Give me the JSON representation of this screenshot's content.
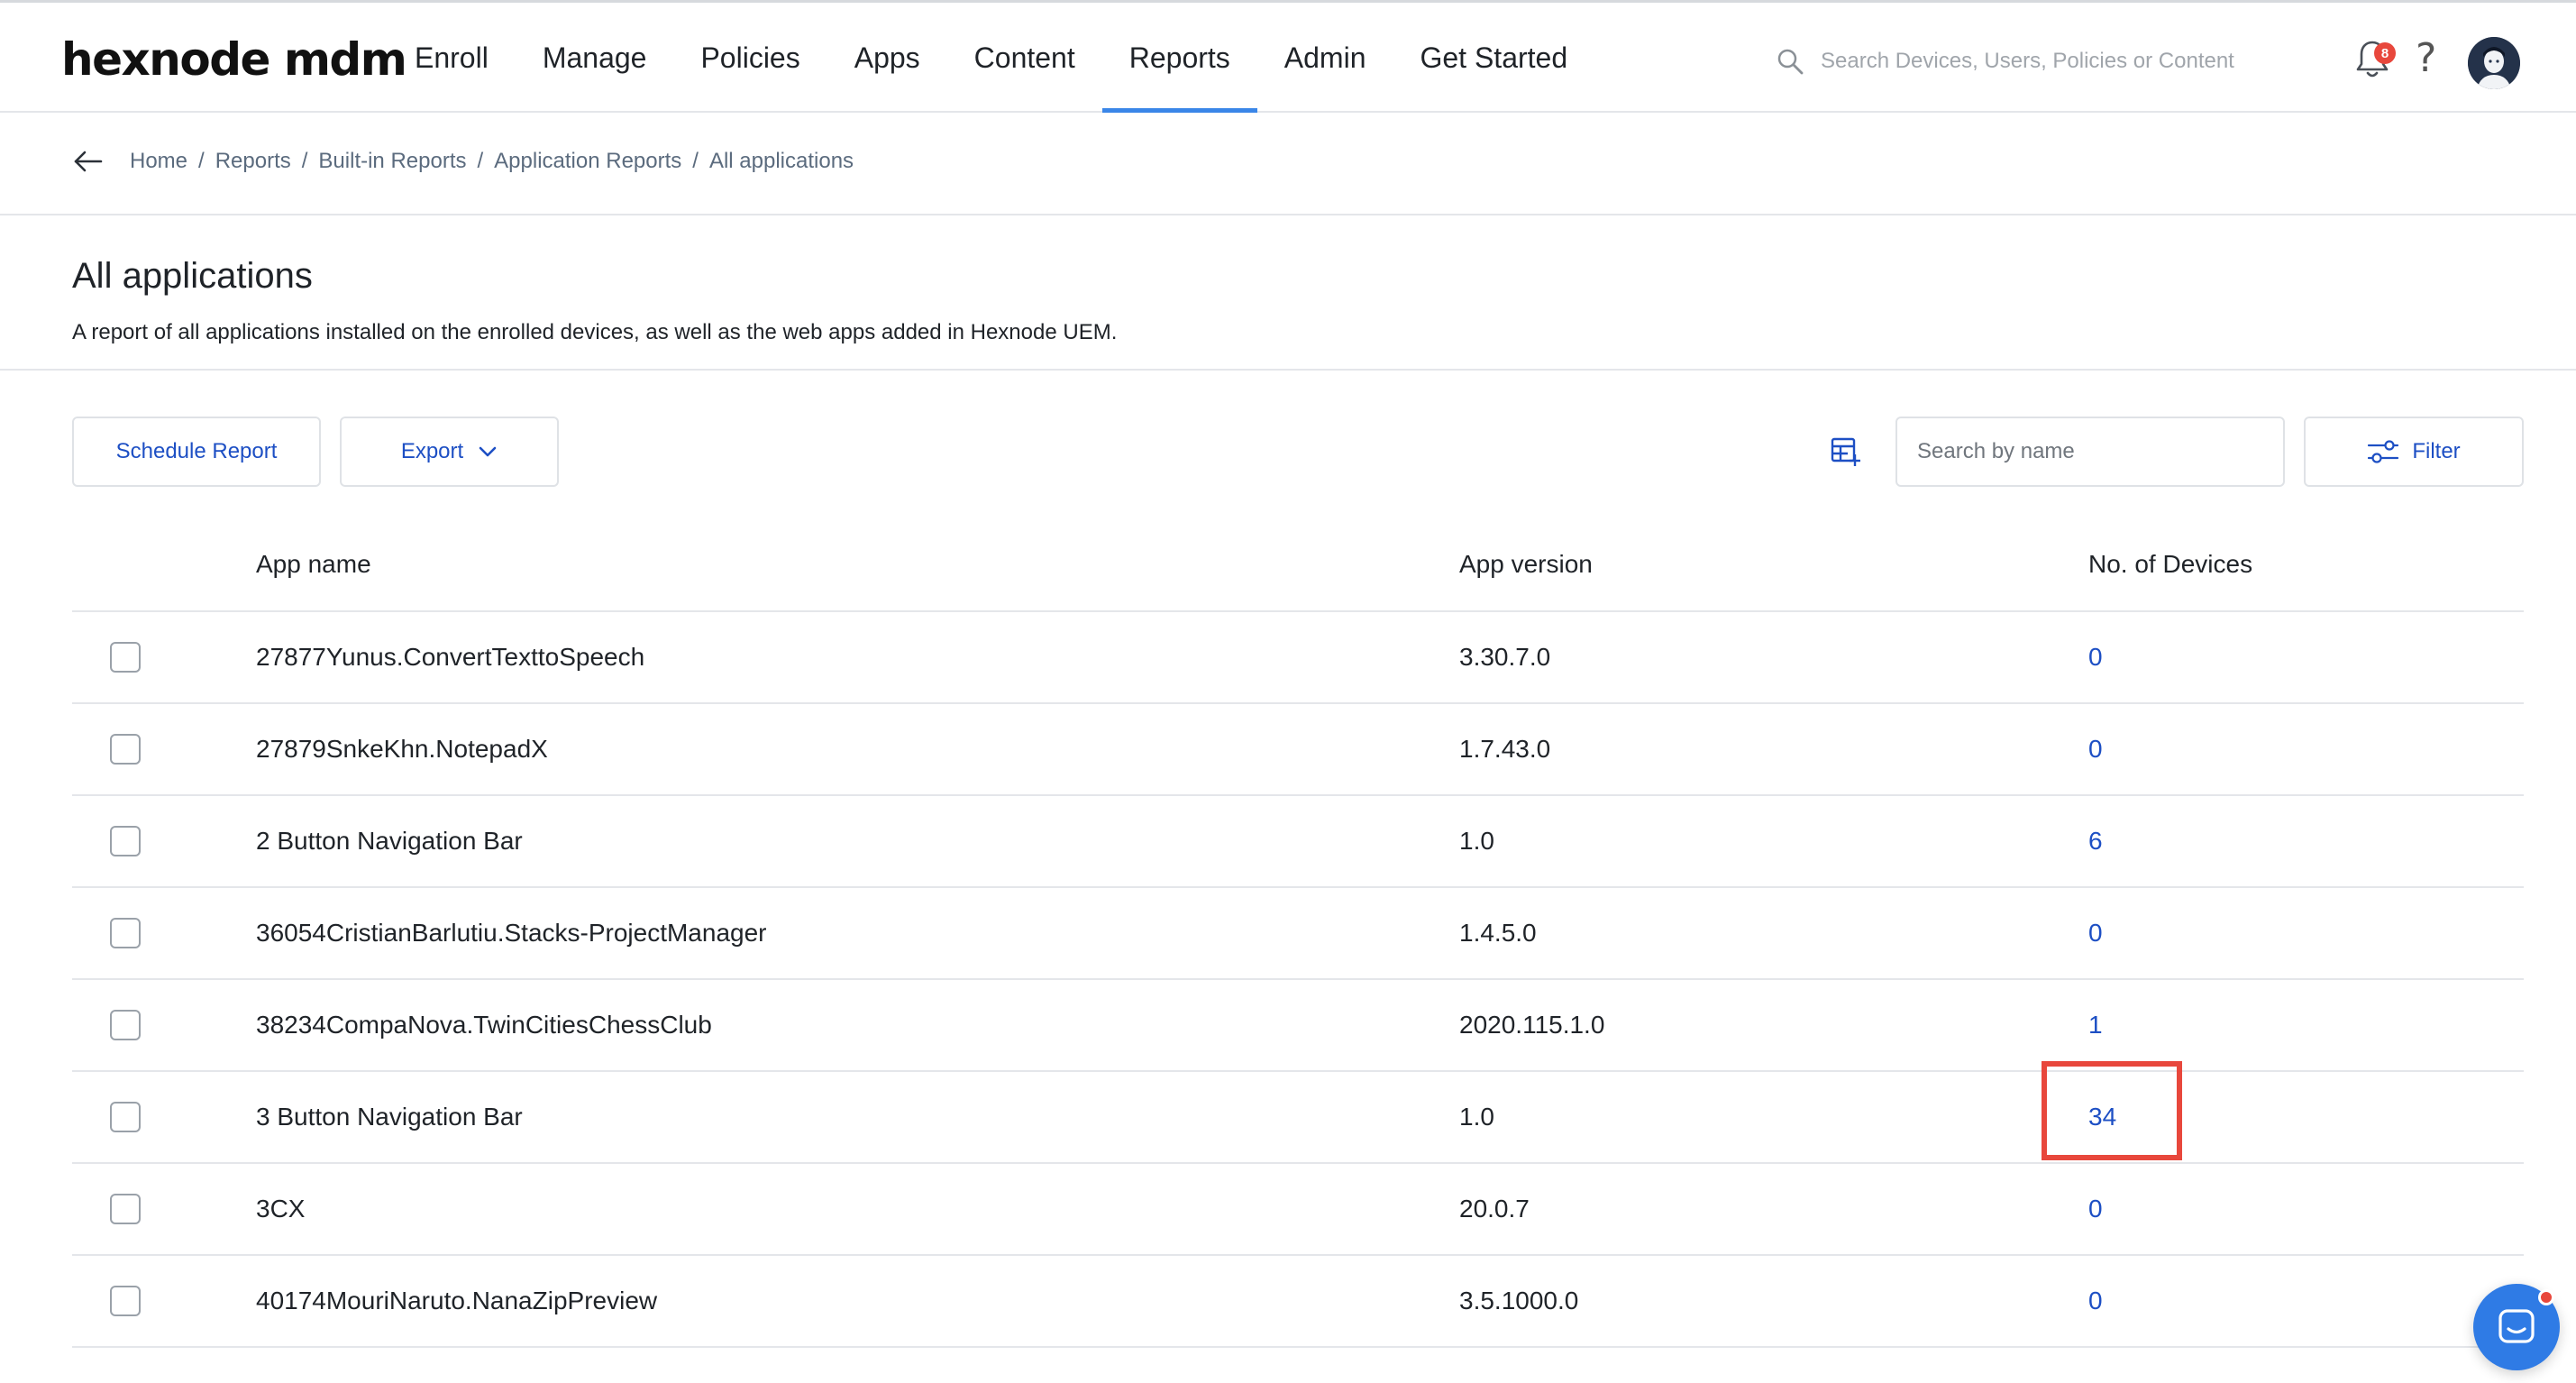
{
  "brand": {
    "logo_text": "hexnode mdm"
  },
  "nav": {
    "items": [
      {
        "label": "Enroll"
      },
      {
        "label": "Manage"
      },
      {
        "label": "Policies"
      },
      {
        "label": "Apps"
      },
      {
        "label": "Content"
      },
      {
        "label": "Reports",
        "active": true
      },
      {
        "label": "Admin"
      },
      {
        "label": "Get Started"
      }
    ]
  },
  "global_search": {
    "placeholder": "Search Devices, Users, Policies or Content"
  },
  "notifications": {
    "count": "8",
    "icon": "bell-icon"
  },
  "help": {
    "label": "?"
  },
  "breadcrumb": {
    "items": [
      {
        "label": "Home"
      },
      {
        "label": "Reports"
      },
      {
        "label": "Built-in Reports"
      },
      {
        "label": "Application Reports"
      },
      {
        "label": "All applications"
      }
    ],
    "separator": "/"
  },
  "page": {
    "title": "All applications",
    "description": "A report of all applications installed on the enrolled devices, as well as the web apps added in Hexnode UEM."
  },
  "toolbar": {
    "schedule_label": "Schedule Report",
    "export_label": "Export",
    "search_placeholder": "Search by name",
    "filter_label": "Filter"
  },
  "table": {
    "headers": {
      "name": "App name",
      "version": "App version",
      "devices": "No. of Devices"
    },
    "rows": [
      {
        "name": "27877Yunus.ConvertTexttoSpeech",
        "version": "3.30.7.0",
        "devices": "0"
      },
      {
        "name": "27879SnkeKhn.NotepadX",
        "version": "1.7.43.0",
        "devices": "0"
      },
      {
        "name": "2 Button Navigation Bar",
        "version": "1.0",
        "devices": "6"
      },
      {
        "name": "36054CristianBarlutiu.Stacks-ProjectManager",
        "version": "1.4.5.0",
        "devices": "0"
      },
      {
        "name": "38234CompaNova.TwinCitiesChessClub",
        "version": "2020.115.1.0",
        "devices": "1"
      },
      {
        "name": "3 Button Navigation Bar",
        "version": "1.0",
        "devices": "34",
        "highlighted": true
      },
      {
        "name": "3CX",
        "version": "20.0.7",
        "devices": "0"
      },
      {
        "name": "40174MouriNaruto.NanaZipPreview",
        "version": "3.5.1000.0",
        "devices": "0"
      }
    ]
  },
  "colors": {
    "accent": "#3a86e8",
    "link": "#1d4fc4",
    "highlight": "#e8473c",
    "chat": "#2f7be5"
  }
}
